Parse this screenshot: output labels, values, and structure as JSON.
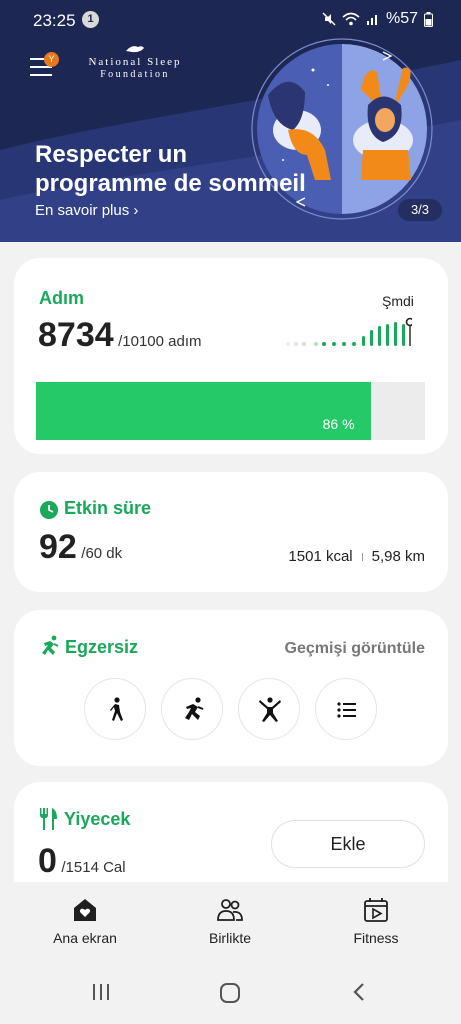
{
  "status_bar": {
    "time": "23:25",
    "notification_count": "1",
    "battery": "%57"
  },
  "banner": {
    "logo_line1": "National Sleep",
    "logo_line2": "Foundation",
    "menu_badge": "Y",
    "title": "Respecter un programme de sommeil",
    "link": "En savoir plus ›",
    "page_indicator": "3/3",
    "colors": {
      "background": "#1d2754",
      "badge": "#e6791c"
    }
  },
  "steps": {
    "title": "Adım",
    "value": "8734",
    "goal": "/10100 adım",
    "now_label": "Şmdi",
    "progress_percent": 86,
    "progress_label": "86 %",
    "color": "#26c967"
  },
  "active_time": {
    "title": "Etkin süre",
    "value": "92",
    "goal": "/60 dk",
    "calories": "1501 kcal",
    "distance": "5,98 km"
  },
  "exercise": {
    "title": "Egzersiz",
    "history_link": "Geçmişi görüntüle",
    "buttons": [
      "walk-icon",
      "run-icon",
      "workout-icon",
      "list-icon"
    ]
  },
  "food": {
    "title": "Yiyecek",
    "value": "0",
    "goal": "/1514 Cal",
    "add_button": "Ekle"
  },
  "bottom_nav": {
    "items": [
      {
        "label": "Ana ekran",
        "icon": "home-heart-icon"
      },
      {
        "label": "Birlikte",
        "icon": "people-icon"
      },
      {
        "label": "Fitness",
        "icon": "fitness-video-icon"
      }
    ]
  }
}
